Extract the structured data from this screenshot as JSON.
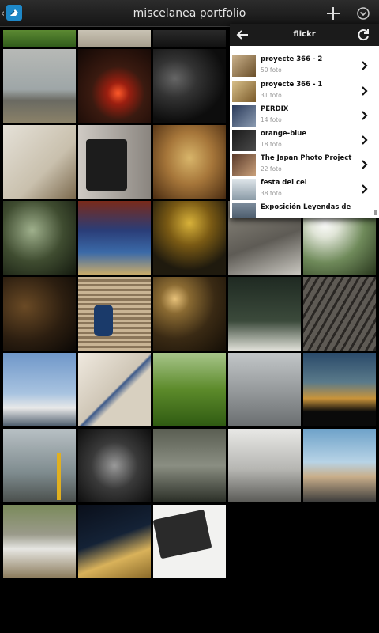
{
  "app": {
    "title": "miscelanea portfolio",
    "icons": [
      "up-caret",
      "app-icon",
      "add-icon",
      "overflow-menu-icon"
    ]
  },
  "accent_colors": {
    "app_icon": "#1e88c8",
    "panel_header": "#1b1b1b"
  },
  "panel": {
    "title": "flickr",
    "back_icon": "arrow-left",
    "refresh_icon": "refresh",
    "albums": [
      {
        "name": "proyecte 366 - 2",
        "count": "50 foto"
      },
      {
        "name": "proyecte 366 - 1",
        "count": "31 foto"
      },
      {
        "name": "PERDIX",
        "count": "14 foto"
      },
      {
        "name": "orange-blue",
        "count": "18 foto"
      },
      {
        "name": "The Japan Photo Project",
        "count": "22 foto"
      },
      {
        "name": "festa del cel",
        "count": "38 foto"
      },
      {
        "name": "Exposición Leyendas de",
        "count": ""
      }
    ]
  },
  "photos": [
    {
      "subject": "green foliage"
    },
    {
      "subject": "pale sky"
    },
    {
      "subject": "dark road"
    },
    {
      "subject": "sea horizon"
    },
    {
      "subject": "red lantern and candles"
    },
    {
      "subject": "vinyl record"
    },
    {
      "subject": "wall lamp"
    },
    {
      "subject": "vintage camera"
    },
    {
      "subject": "cardboard robot face"
    },
    {
      "subject": "window shadow"
    },
    {
      "subject": "bicycle wheel"
    },
    {
      "subject": "camera with bokeh"
    },
    {
      "subject": "road marking"
    },
    {
      "subject": "white flowers"
    },
    {
      "subject": "dark chair"
    },
    {
      "subject": "skateboarder"
    },
    {
      "subject": "golden bokeh"
    },
    {
      "subject": "small figure on table"
    },
    {
      "subject": "wooden boardwalk"
    },
    {
      "subject": "coastal houses"
    },
    {
      "subject": "tree shadow on snow"
    },
    {
      "subject": "grass and flowers"
    },
    {
      "subject": "wet pavement"
    },
    {
      "subject": "sunset sea"
    },
    {
      "subject": "yellow crane"
    },
    {
      "subject": "stage with lights"
    },
    {
      "subject": "reflection on water"
    },
    {
      "subject": "building and wires"
    },
    {
      "subject": "rock and sky"
    },
    {
      "subject": "boats on shore"
    },
    {
      "subject": "umbrella"
    },
    {
      "subject": "notebook and pen"
    }
  ]
}
